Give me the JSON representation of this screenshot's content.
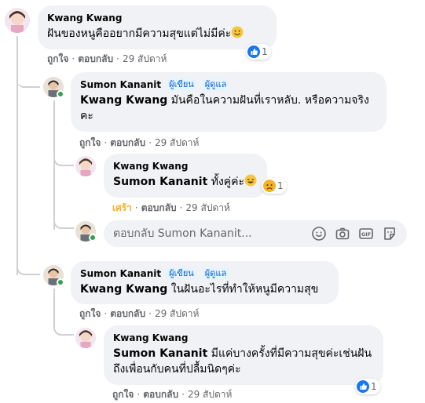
{
  "comments": [
    {
      "author": "Kwang Kwang",
      "text": "ฝันของหนูคืออยากมีความสุขแต่ไม่มีค่ะ",
      "like": "ถูกใจ",
      "reply": "ตอบกลับ",
      "time": "29 สัปดาห์",
      "reaction_count": "1"
    },
    {
      "author": "Sumon Kananit",
      "badge_author": "ผู้เขียน",
      "badge_admin": "ผู้ดูแล",
      "mention": "Kwang Kwang",
      "text": " มันคือในความฝันที่เราหลับ. หรือความจริงคะ",
      "like": "ถูกใจ",
      "reply": "ตอบกลับ",
      "time": "29 สัปดาห์"
    },
    {
      "author": "Kwang Kwang",
      "mention": "Sumon Kananit",
      "text": " ทั้งคู่ค่ะ",
      "like": "เศร้า",
      "reply": "ตอบกลับ",
      "time": "29 สัปดาห์",
      "reaction_count": "1"
    },
    {
      "author": "Sumon Kananit",
      "badge_author": "ผู้เขียน",
      "badge_admin": "ผู้ดูแล",
      "mention": "Kwang Kwang",
      "text": " ในฝันอะไรที่ทำให้หนูมีความสุข",
      "like": "ถูกใจ",
      "reply": "ตอบกลับ",
      "time": "29 สัปดาห์"
    },
    {
      "author": "Kwang Kwang",
      "mention": "Sumon Kananit",
      "text": " มีแค่บางครั้งที่มีความสุขค่ะเช่นฝันถึงเพื่อนกับคนที่ปลื้มนิดๆค่ะ",
      "like": "ถูกใจ",
      "reply": "ตอบกลับ",
      "time": "29 สัปดาห์",
      "reaction_count": "1"
    }
  ],
  "reply_box": {
    "placeholder": "ตอบกลับ Sumon Kananit..."
  },
  "icons": [
    "emoji-icon",
    "camera-icon",
    "gif-icon",
    "sticker-icon",
    "like-reaction-icon",
    "sad-reaction-icon",
    "haha-emoji-icon"
  ],
  "colors": {
    "bubble": "#f0f2f5",
    "meta": "#65676b",
    "badge_text": "#0064d1",
    "badge_bg": "#e7f3ff",
    "like_blue": "#1877f2",
    "online": "#31a24c",
    "sad_yellow": "#f7b125"
  }
}
